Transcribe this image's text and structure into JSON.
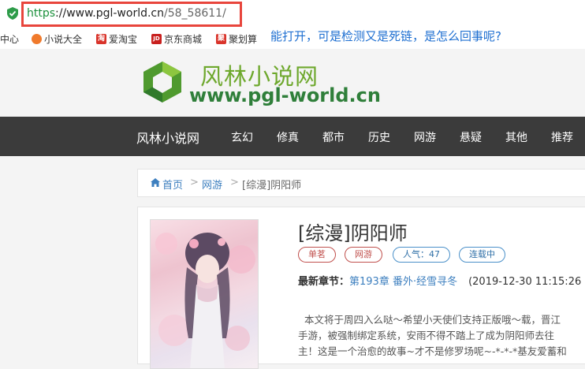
{
  "browser": {
    "url_scheme": "https",
    "url_host": "://www.pgl-world.cn",
    "url_path": "/58_58611/",
    "bookmarks": [
      {
        "label": "中心",
        "icon": "none"
      },
      {
        "label": "小说大全",
        "icon": "novel-icon",
        "color": "#f07a2c"
      },
      {
        "label": "爱淘宝",
        "icon": "taobao-icon",
        "color": "#d9342b",
        "glyph": "淘"
      },
      {
        "label": "京东商城",
        "icon": "jd-icon",
        "color": "#c8201e",
        "glyph": "JD"
      },
      {
        "label": "聚划算",
        "icon": "juhuasuan-icon",
        "color": "#d9342b",
        "glyph": "聚"
      }
    ]
  },
  "annotation": "能打开，可是检测又是死链，是怎么回事呢?",
  "site": {
    "logo_title": "风林小说网",
    "logo_url": "www.pgl-world.cn",
    "brand": "风林小说网",
    "nav": [
      "玄幻",
      "修真",
      "都市",
      "历史",
      "网游",
      "悬疑",
      "其他",
      "推荐"
    ],
    "accent": "#6ea82d"
  },
  "breadcrumb": {
    "home": "首页",
    "sep1": ">",
    "category": "网游",
    "sep2": ">",
    "current": "[综漫]阴阳师"
  },
  "book": {
    "title": "[综漫]阴阳师",
    "author": "单茗",
    "category": "网游",
    "popularity": "人气：47",
    "status": "连载中",
    "latest_label": "最新章节：",
    "latest_chapter": "第193章 番外·经雪寻冬",
    "latest_time": "(2019-12-30 11:15:26",
    "description": [
      "本文将于周四入么哒～希望小天使们支持正版哦～载，晋江",
      "手游，被强制绑定系统，安雨不得不踏上了成为阴阳师去往",
      "主！这是一个治愈的故事~才不是修罗场呢~-*-*-*基友爱蓄和"
    ]
  }
}
